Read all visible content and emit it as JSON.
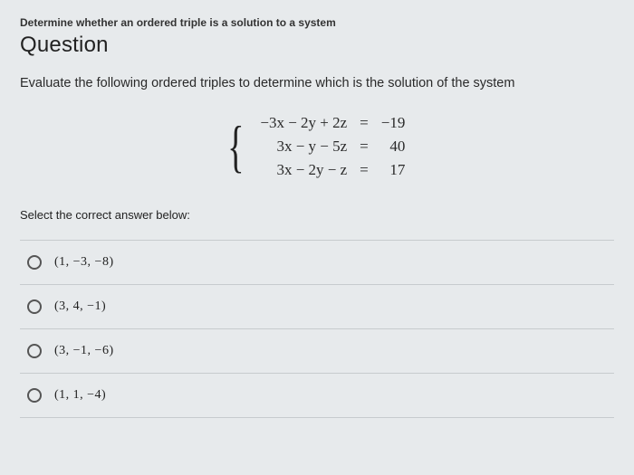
{
  "topic": "Determine whether an ordered triple is a solution to a system",
  "heading": "Question",
  "prompt": "Evaluate the following ordered triples to determine which is the solution of the system",
  "system": {
    "rows": [
      {
        "lhs": "−3x − 2y + 2z",
        "eq": "=",
        "rhs": "−19"
      },
      {
        "lhs": "3x − y − 5z",
        "eq": "=",
        "rhs": "40"
      },
      {
        "lhs": "3x − 2y − z",
        "eq": "=",
        "rhs": "17"
      }
    ]
  },
  "select_label": "Select the correct answer below:",
  "options": [
    {
      "label": "(1, −3, −8)"
    },
    {
      "label": "(3, 4, −1)"
    },
    {
      "label": "(3, −1, −6)"
    },
    {
      "label": "(1, 1, −4)"
    }
  ]
}
